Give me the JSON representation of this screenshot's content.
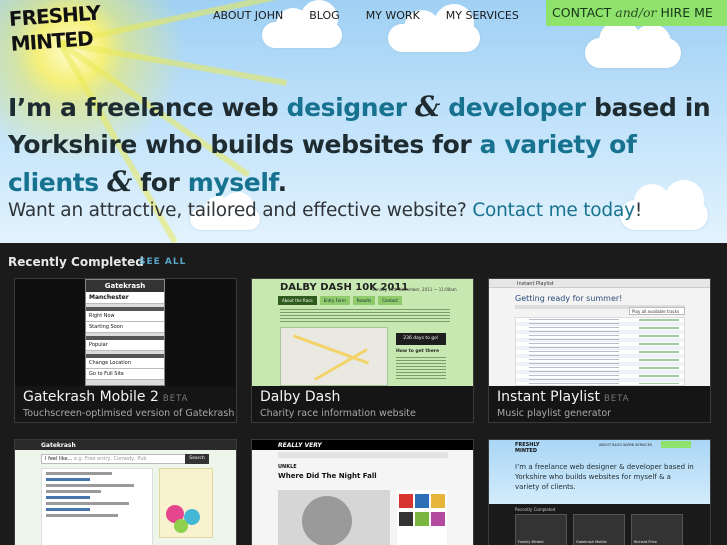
{
  "brand": {
    "logo_line1": "FRESHLY",
    "logo_line2": "MINTED"
  },
  "nav": {
    "items": [
      "ABOUT JOHN",
      "BLOG",
      "MY WORK",
      "MY SERVICES"
    ],
    "contact_label": "CONTACT",
    "contact_joiner": "and/or",
    "contact_hire": "HIRE ME"
  },
  "hero": {
    "part1": "I’m a freelance web ",
    "designer": "designer",
    "amp1": "&",
    "developer": "developer",
    "part2": " based in Yorkshire who builds websites for ",
    "variety": "a variety of clients",
    "amp2": "&",
    "part3": " for ",
    "myself": "myself",
    "part4": ".",
    "sub_text": "Want an attractive, tailored and effective website? ",
    "sub_link": "Contact me today",
    "sub_end": "!"
  },
  "recent": {
    "title": "Recently Completed",
    "see_all": "SEE ALL",
    "projects": [
      {
        "name": "Gatekrash Mobile 2",
        "badge": "BETA",
        "desc": "Touchscreen-optimised version of Gatekrash",
        "shot": {
          "header": "Gatekrash",
          "city": "Manchester",
          "rows": [
            "Right Now",
            "Starting Soon",
            "Popular",
            "Change Location",
            "Go to Full Site"
          ]
        }
      },
      {
        "name": "Dalby Dash",
        "badge": "",
        "desc": "Charity race information website",
        "shot": {
          "title": "DALBY DASH 10K 2011",
          "date": "Sunday 13th November, 2011 — 11:00am",
          "tabs": [
            "About the Race",
            "Entry Form",
            "Results",
            "Contact"
          ],
          "days": "236 days to go!",
          "how": "How to get there"
        }
      },
      {
        "name": "Instant Playlist",
        "badge": "BETA",
        "desc": "Music playlist generator",
        "shot": {
          "brand": "Instant Playlist",
          "title": "Getting ready for summer!",
          "button": "Play all available tracks"
        }
      }
    ],
    "more_shots": [
      {
        "brand": "Gatekrash",
        "search_value": "I feel like...",
        "search_tail": "e.g. Free entry, Comedy, Pub",
        "search_button": "Search"
      },
      {
        "brand": "REALLY VERY",
        "label": "UNKLE",
        "title": "Where Did The Night Fall"
      },
      {
        "logo_line1": "FRESHLY",
        "logo_line2": "MINTED",
        "nav": "ABOUT  BLOG  WORK  SERVICES",
        "headline": "I’m a freelance web designer & developer based in Yorkshire who builds websites for myself & a variety of clients.",
        "recent": "Recently Completed",
        "cards": [
          "Freshly Minted",
          "Gatekrash Mobile",
          "Richard Price"
        ]
      }
    ]
  },
  "colors": {
    "accent": "#17728f",
    "contact_bg": "#8fe36c",
    "page_bg": "#1b1b1b"
  }
}
